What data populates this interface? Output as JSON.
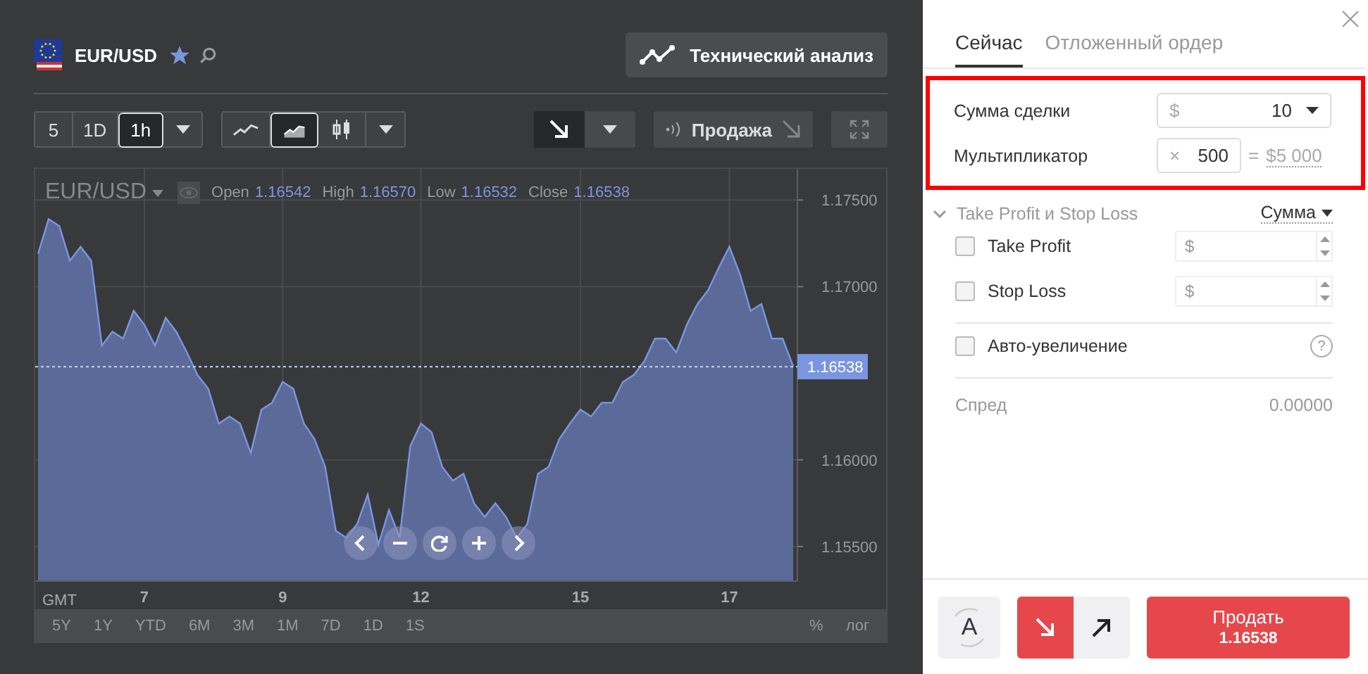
{
  "symbol": {
    "name": "EUR/USD",
    "favorite": true
  },
  "analysis_button": "Технический анализ",
  "intervals": [
    {
      "label": "5",
      "selected": false
    },
    {
      "label": "1D",
      "selected": false
    },
    {
      "label": "1h",
      "selected": true
    }
  ],
  "chart_types": [
    {
      "kind": "line",
      "selected": false
    },
    {
      "kind": "area",
      "selected": true
    },
    {
      "kind": "candles",
      "selected": false
    }
  ],
  "sell_button": "Продажа",
  "chart": {
    "legend": {
      "fields": [
        {
          "label": "Open",
          "value": "1.16542"
        },
        {
          "label": "High",
          "value": "1.16570"
        },
        {
          "label": "Low",
          "value": "1.16532"
        },
        {
          "label": "Close",
          "value": "1.16538"
        }
      ]
    },
    "timezone": "GMT",
    "chart_data": {
      "type": "area",
      "grid": true,
      "ref_lines": [
        {
          "axis": "y",
          "value": 1.16538,
          "label": "1.16538"
        }
      ],
      "categories": [
        null,
        null,
        null,
        null,
        null,
        null,
        null,
        null,
        null,
        null,
        "7",
        null,
        null,
        null,
        null,
        null,
        null,
        null,
        null,
        null,
        null,
        null,
        null,
        "9",
        null,
        null,
        null,
        null,
        null,
        null,
        null,
        null,
        null,
        null,
        null,
        null,
        "12",
        null,
        null,
        null,
        null,
        null,
        null,
        null,
        null,
        null,
        null,
        null,
        null,
        null,
        null,
        "15",
        null,
        null,
        null,
        null,
        null,
        null,
        null,
        null,
        null,
        null,
        null,
        null,
        null,
        "17",
        null,
        null,
        null,
        null,
        null,
        null
      ],
      "series": [
        {
          "name": "EUR/USD",
          "color": "#7b96e0",
          "values": [
            1.1719,
            1.1739,
            1.1735,
            1.1715,
            1.1723,
            1.1715,
            1.1666,
            1.1674,
            1.167,
            1.1686,
            1.1678,
            1.1666,
            1.1682,
            1.1674,
            1.1662,
            1.1649,
            1.1641,
            1.1621,
            1.1625,
            1.1621,
            1.1604,
            1.1629,
            1.1633,
            1.1645,
            1.1641,
            1.1621,
            1.1612,
            1.1596,
            1.1559,
            1.1555,
            1.1563,
            1.158,
            1.1551,
            1.1571,
            1.1555,
            1.1608,
            1.1621,
            1.1616,
            1.1596,
            1.1588,
            1.1592,
            1.1575,
            1.1567,
            1.1575,
            1.1567,
            1.1555,
            1.1563,
            1.1592,
            1.1596,
            1.1612,
            1.1621,
            1.1629,
            1.1625,
            1.1633,
            1.1633,
            1.1645,
            1.1649,
            1.1657,
            1.167,
            1.167,
            1.1662,
            1.1678,
            1.169,
            1.1698,
            1.1711,
            1.1723,
            1.1707,
            1.1686,
            1.169,
            1.167,
            1.167,
            1.1654
          ]
        }
      ],
      "ylim": [
        1.153,
        1.1768
      ],
      "yticks": [
        {
          "value": 1.155,
          "label": "1.15500"
        },
        {
          "value": 1.16,
          "label": "1.16000"
        },
        {
          "value": 1.17,
          "label": "1.17000"
        },
        {
          "value": 1.175,
          "label": "1.17500"
        }
      ]
    }
  },
  "ranges": [
    "5Y",
    "1Y",
    "YTD",
    "6M",
    "3M",
    "1M",
    "7D",
    "1D",
    "1S"
  ],
  "scale_options": [
    "%",
    "лог"
  ],
  "order_panel": {
    "tabs": [
      {
        "label": "Сейчас",
        "selected": true
      },
      {
        "label": "Отложенный ордер",
        "selected": false
      }
    ],
    "amount": {
      "label": "Сумма сделки",
      "currency": "$",
      "value": "10"
    },
    "multiplier": {
      "label": "Мультипликатор",
      "prefix": "×",
      "value": "500",
      "equals": "=",
      "total": "$5 000"
    },
    "tp_sl": {
      "label": "Take Profit и Stop Loss",
      "expanded": true,
      "mode": "Сумма",
      "rows": [
        {
          "label": "Take Profit",
          "checked": false,
          "placeholder": "$"
        },
        {
          "label": "Stop Loss",
          "checked": false,
          "placeholder": "$"
        }
      ]
    },
    "auto_increase": {
      "label": "Авто-увеличение",
      "checked": false,
      "help": "?"
    },
    "spread": {
      "label": "Спред",
      "value": "0.00000"
    },
    "auto_button": "A",
    "directions": [
      {
        "kind": "sell",
        "selected": true
      },
      {
        "kind": "buy",
        "selected": false
      }
    ],
    "submit": {
      "label": "Продать",
      "price": "1.16538"
    }
  }
}
